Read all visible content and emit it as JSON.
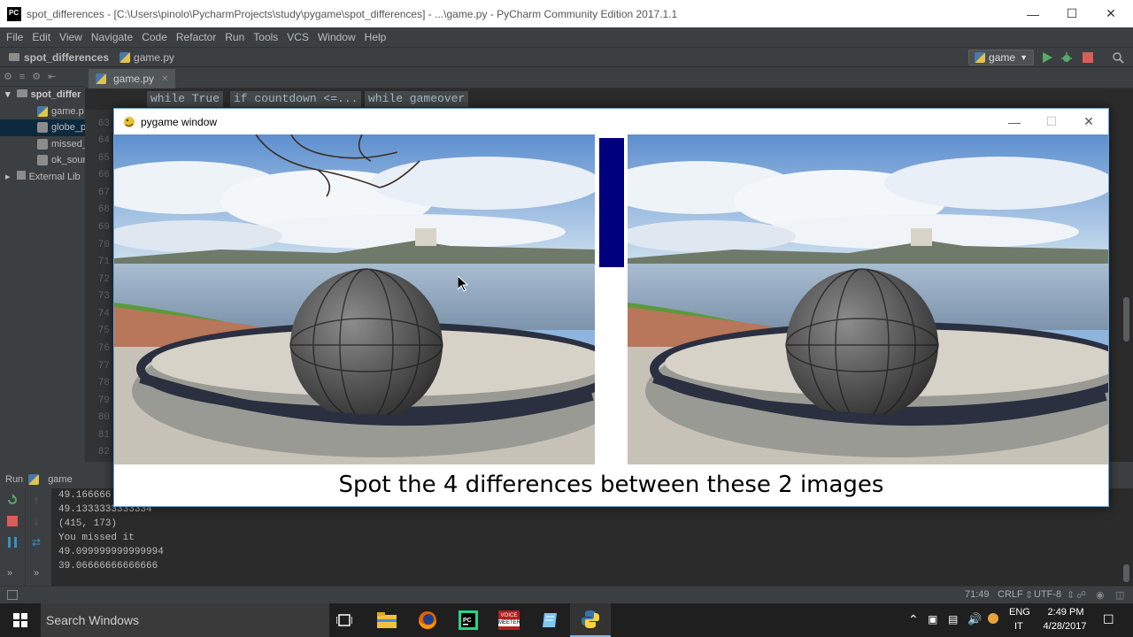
{
  "ide": {
    "title": "spot_differences - [C:\\Users\\pinolo\\PycharmProjects\\study\\pygame\\spot_differences] - ...\\game.py - PyCharm Community Edition 2017.1.1",
    "menu": [
      "File",
      "Edit",
      "View",
      "Navigate",
      "Code",
      "Refactor",
      "Run",
      "Tools",
      "VCS",
      "Window",
      "Help"
    ],
    "nav_project": "spot_differences",
    "nav_file": "game.py",
    "run_config": "game",
    "editor_tab": "game.py",
    "breadcrumbs": [
      "while True",
      "if countdown <=...",
      "while gameover"
    ],
    "project_tree": [
      "spot_differ",
      "game.p",
      "globe_p",
      "missed_",
      "ok_sour",
      "External Lib"
    ],
    "line_numbers": [
      "63",
      "64",
      "65",
      "66",
      "67",
      "68",
      "69",
      "70",
      "71",
      "72",
      "73",
      "74",
      "75",
      "76",
      "77",
      "78",
      "79",
      "80",
      "81",
      "82"
    ]
  },
  "run": {
    "label": "Run",
    "config": "game",
    "console_lines": [
      "49.166666",
      "49.1333333333334",
      "(415, 173)",
      "You missed it",
      "49.099999999999994",
      "39.06666666666666"
    ]
  },
  "status": {
    "position": "71:49",
    "line_sep": "CRLF",
    "encoding": "UTF-8"
  },
  "pygame": {
    "title": "pygame window",
    "caption": "Spot the 4 differences between these 2 images"
  },
  "taskbar": {
    "search": "Search Windows",
    "lang_top": "ENG",
    "lang_bottom": "IT",
    "time": "2:49 PM",
    "date": "4/28/2017",
    "voicemeeter_top": "VOICE",
    "voicemeeter_bottom": "MEETER"
  }
}
